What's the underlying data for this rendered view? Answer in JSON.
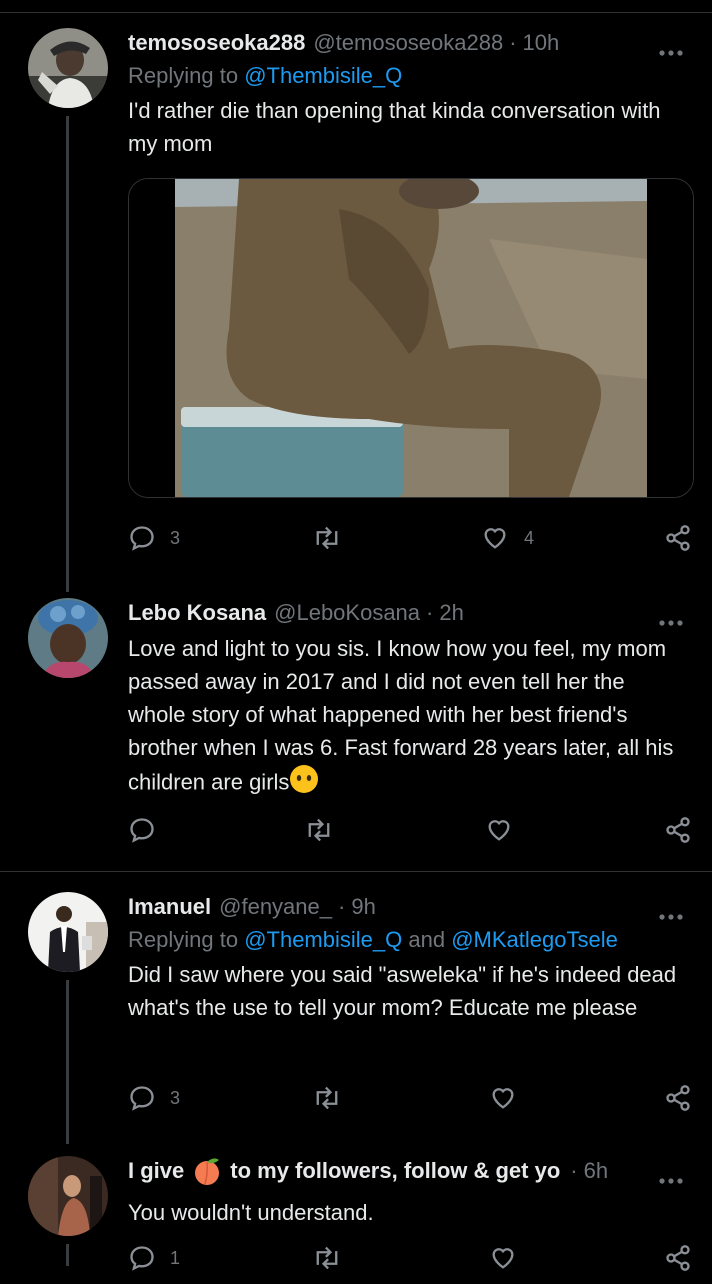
{
  "tweets": [
    {
      "name": "temososeoka288",
      "handle": "@temososeoka288",
      "time": "10h",
      "reply_prefix": "Replying to ",
      "reply_to": "@Thembisile_Q",
      "text": "I'd rather die than opening that kinda conversation with my mom",
      "reply_count": "3",
      "retweet_count": "",
      "like_count": "4"
    },
    {
      "name": "Lebo Kosana",
      "handle": "@LeboKosana",
      "time": "2h",
      "text": "Love and light to you sis. I know how you feel, my mom passed away in 2017 and I did not even tell her the whole story of what happened with her best friend's brother when I was 6. Fast forward 28 years later, all his children are girls",
      "reply_count": "",
      "retweet_count": "",
      "like_count": ""
    },
    {
      "name": "Imanuel",
      "handle": "@fenyane_",
      "time": "9h",
      "reply_prefix": "Replying to ",
      "reply_to": "@Thembisile_Q",
      "reply_and": " and ",
      "reply_to2": "@MKatlegoTsele",
      "text": "Did I saw where you said \"asweleka\" if he's indeed dead what's the use to tell your mom? Educate me please",
      "reply_count": "3",
      "retweet_count": "",
      "like_count": ""
    },
    {
      "name_part1": "I give",
      "name_part2": "to my followers, follow & get yo",
      "time": "6h",
      "text": "You wouldn't understand.",
      "reply_count": "1"
    }
  ],
  "icons": {
    "more": "more-horizontal-icon",
    "reply": "reply-bubble-icon",
    "retweet": "retweet-icon",
    "like": "heart-icon",
    "share": "share-icon",
    "emoji1": "face-without-mouth-emoji",
    "emoji2": "peach-emoji"
  },
  "colors": {
    "background": "#000000",
    "link": "#1d9bf0",
    "muted": "#71767b",
    "text": "#e7e9ea"
  }
}
